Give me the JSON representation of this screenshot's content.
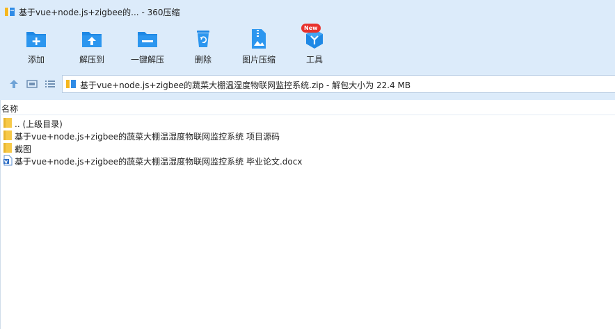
{
  "window": {
    "title": "基于vue+node.js+zigbee的... - 360压缩"
  },
  "toolbar": {
    "add": "添加",
    "extract_to": "解压到",
    "one_click_extract": "一键解压",
    "delete": "删除",
    "image_compress": "图片压缩",
    "tools": "工具",
    "tools_badge": "New"
  },
  "address": {
    "path": "基于vue+node.js+zigbee的蔬菜大棚温湿度物联网监控系统.zip - 解包大小为 22.4 MB"
  },
  "columns": {
    "name": "名称"
  },
  "files": [
    {
      "name": ".. (上级目录)",
      "type": "folder"
    },
    {
      "name": "基于vue+node.js+zigbee的蔬菜大棚温湿度物联网监控系统 项目源码",
      "type": "folder"
    },
    {
      "name": "截图",
      "type": "folder"
    },
    {
      "name": "基于vue+node.js+zigbee的蔬菜大棚温湿度物联网监控系统 毕业论文.docx",
      "type": "docx"
    }
  ],
  "colors": {
    "chrome_bg": "#dcebfa",
    "accent_blue": "#1e88e5",
    "folder": "#f7c948"
  }
}
